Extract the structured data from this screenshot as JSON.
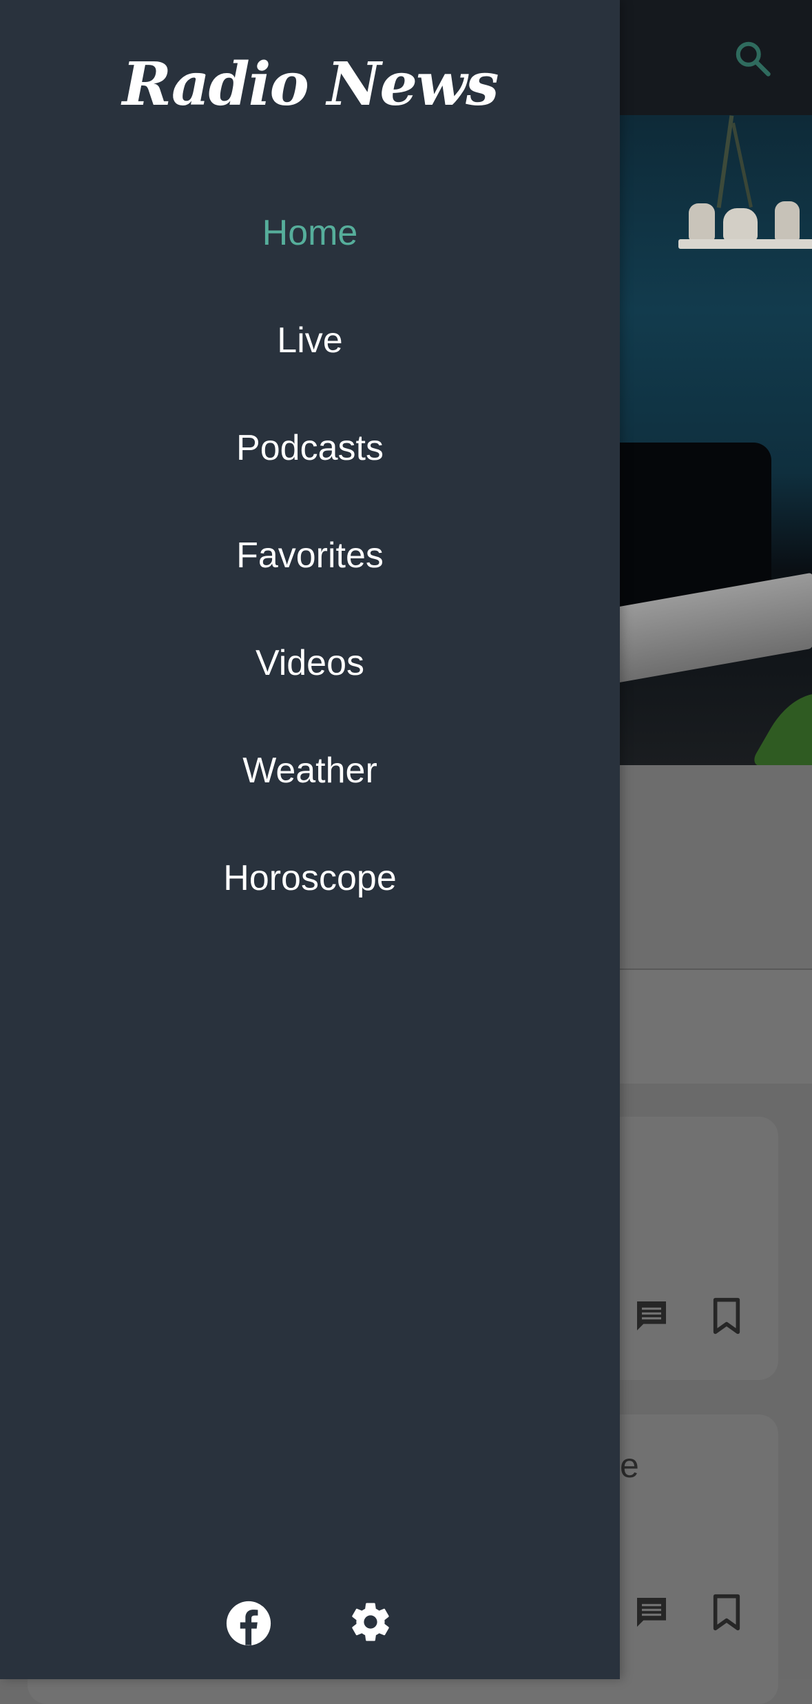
{
  "app": {
    "logo_text": "Radio News",
    "accent_color": "#56ae9b",
    "drawer_color": "#29323d"
  },
  "drawer": {
    "menu": [
      {
        "label": "Home",
        "active": true
      },
      {
        "label": "Live",
        "active": false
      },
      {
        "label": "Podcasts",
        "active": false
      },
      {
        "label": "Favorites",
        "active": false
      },
      {
        "label": "Videos",
        "active": false
      },
      {
        "label": "Weather",
        "active": false
      },
      {
        "label": "Horoscope",
        "active": false
      }
    ],
    "footer_icons": [
      "facebook-icon",
      "settings-icon"
    ]
  },
  "background": {
    "topbar_icons": [
      "search-icon"
    ],
    "card_2_partial_text": "e",
    "card_icons": [
      "comment-icon",
      "bookmark-icon"
    ]
  }
}
